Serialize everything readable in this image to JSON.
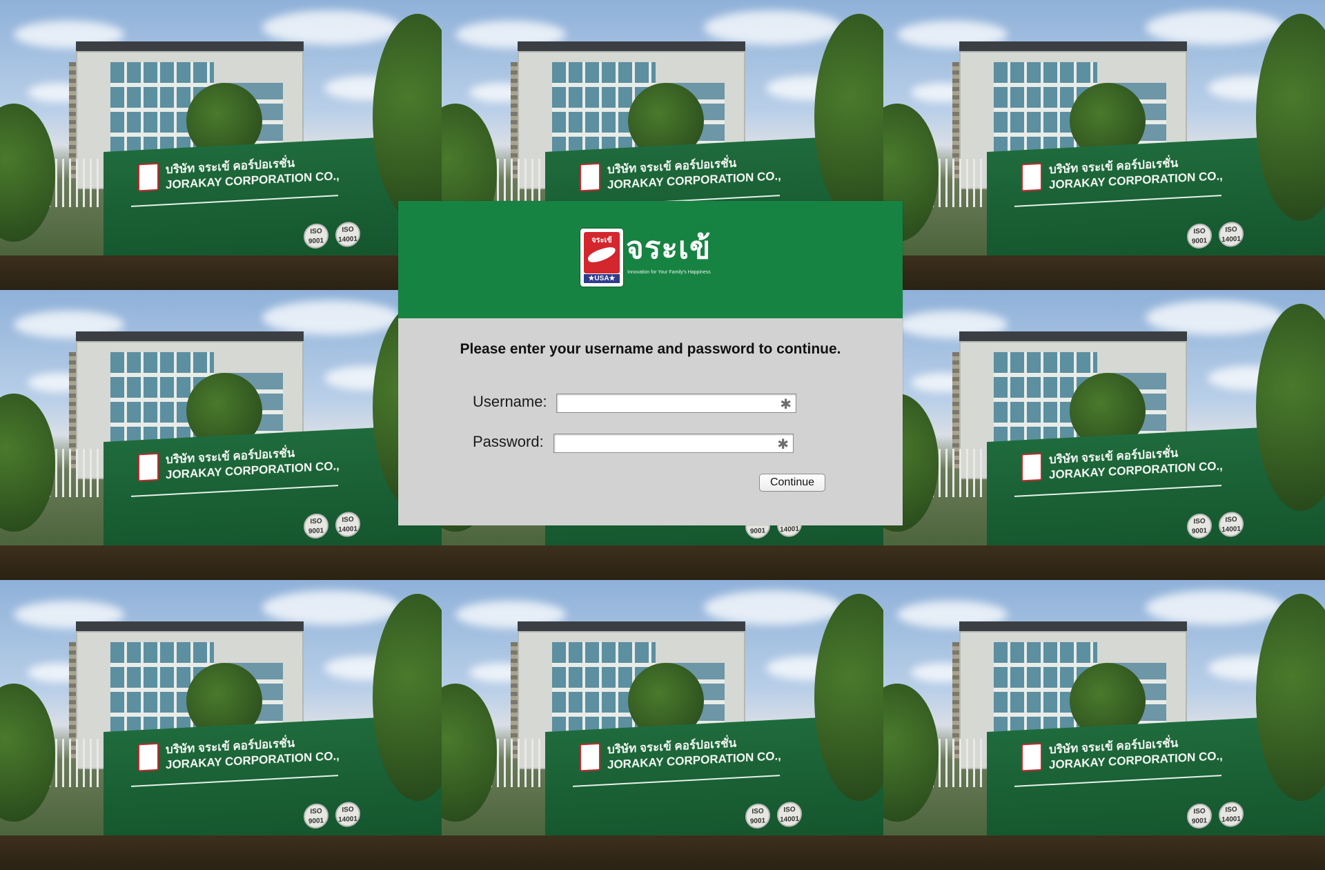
{
  "background": {
    "tile_count": 9,
    "sign_thai": "บริษัท จระเข้ คอร์ปอเรชั่น",
    "sign_english": "JORAKAY CORPORATION CO.,",
    "iso_badges": [
      "ISO 9001",
      "ISO 14001"
    ]
  },
  "banner": {
    "color": "#178342",
    "logo_word": "จระเข้",
    "badge_word": "จระเข้",
    "badge_usa": "★USA★",
    "tagline": "Innovation for Your Family's Happiness"
  },
  "form": {
    "prompt": "Please enter your username and password to continue.",
    "username_label": "Username:",
    "password_label": "Password:",
    "username_value": "",
    "password_value": "",
    "required_marker": "✱",
    "continue_label": "Continue"
  }
}
